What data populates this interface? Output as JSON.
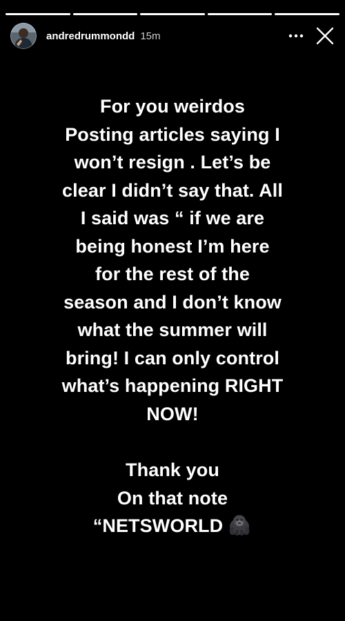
{
  "story": {
    "progress": {
      "segments": [
        1,
        1,
        1,
        1,
        1
      ]
    },
    "header": {
      "username": "andredrummondd",
      "timestamp": "15m",
      "avatar_icon": "profile-avatar",
      "more_icon": "more-horizontal-icon",
      "close_icon": "close-icon"
    },
    "text": {
      "paragraph1": [
        "For you weirdos",
        "Posting articles saying I",
        "won’t resign . Let’s be",
        "clear I didn’t say that. All",
        "I said was “ if we are",
        "being honest I’m here",
        "for the rest of the",
        "season and I don’t know",
        "what the summer will",
        "bring! I can only control",
        "what’s happening RIGHT",
        "NOW!"
      ],
      "paragraph2": [
        "Thank you",
        "On that note",
        "“NETSWORLD"
      ],
      "trailing_emoji": "gorilla-emoji"
    },
    "colors": {
      "background": "#000000",
      "text": "#ffffff"
    }
  }
}
